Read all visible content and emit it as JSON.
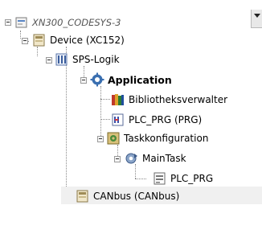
{
  "tree": {
    "project": {
      "label": "XN300_CODESYS-3",
      "icon": "project-icon"
    },
    "device": {
      "label": "Device (XC152)",
      "icon": "device-icon"
    },
    "plc_logic": {
      "label": "SPS-Logik",
      "icon": "plc-logic-icon"
    },
    "application": {
      "label": "Application",
      "icon": "application-gear-icon"
    },
    "library_manager": {
      "label": "Bibliotheksverwalter",
      "icon": "library-books-icon"
    },
    "plc_prg": {
      "label": "PLC_PRG (PRG)",
      "icon": "program-icon"
    },
    "task_config": {
      "label": "Taskkonfiguration",
      "icon": "task-configuration-icon"
    },
    "main_task": {
      "label": "MainTask",
      "icon": "task-icon"
    },
    "task_plc_prg": {
      "label": "PLC_PRG",
      "icon": "program-call-icon"
    },
    "canbus": {
      "label": "CANbus (CANbus)",
      "icon": "canbus-device-icon"
    }
  },
  "colors": {
    "background": "#ffffff",
    "connector": "#8a8a8a",
    "application_icon": "#3a6fb0"
  }
}
